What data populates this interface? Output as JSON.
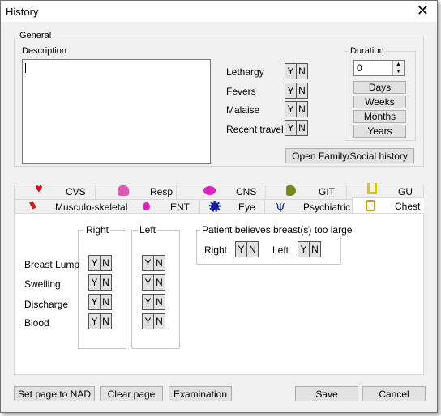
{
  "window": {
    "title": "History",
    "close_glyph": "✕"
  },
  "general": {
    "legend": "General",
    "description_label": "Description",
    "description_value": "",
    "symptoms": [
      {
        "label": "Lethargy",
        "yes": "Y",
        "no": "N"
      },
      {
        "label": "Fevers",
        "yes": "Y",
        "no": "N"
      },
      {
        "label": "Malaise",
        "yes": "Y",
        "no": "N"
      },
      {
        "label": "Recent travel",
        "yes": "Y",
        "no": "N"
      }
    ],
    "family_button": "Open Family/Social history",
    "duration": {
      "legend": "Duration",
      "value": "0",
      "buttons": [
        "Days",
        "Weeks",
        "Months",
        "Years"
      ]
    }
  },
  "tabs": {
    "back_row": [
      {
        "label": "CVS",
        "icon": "heart-icon",
        "color": "#e0001b"
      },
      {
        "label": "Resp",
        "icon": "lungs-icon",
        "color": "#e05ab4"
      },
      {
        "label": "CNS",
        "icon": "brain-icon",
        "color": "#e020c0"
      },
      {
        "label": "GIT",
        "icon": "stomach-icon",
        "color": "#7a8a1a"
      },
      {
        "label": "GU",
        "icon": "kidney-icon",
        "color": "#d8c800"
      }
    ],
    "front_row": [
      {
        "label": "Musculo-skeletal",
        "icon": "bone-icon",
        "color": "#d02020"
      },
      {
        "label": "ENT",
        "icon": "ear-icon",
        "color": "#e020c0"
      },
      {
        "label": "Eye",
        "icon": "eye-icon",
        "color": "#1020a0"
      },
      {
        "label": "Psychiatric",
        "icon": "psi-icon",
        "color": "#1030a0"
      },
      {
        "label": "Chest",
        "icon": "chest-icon",
        "color": "#c8a000",
        "selected": true
      }
    ]
  },
  "chest": {
    "right_legend": "Right",
    "left_legend": "Left",
    "rows": [
      "Breast Lump",
      "Swelling",
      "Discharge",
      "Blood"
    ],
    "yes": "Y",
    "no": "N",
    "believes": {
      "legend": "Patient believes breast(s) too large",
      "right_label": "Right",
      "left_label": "Left"
    }
  },
  "footer": {
    "nad_button": "Set page to NAD",
    "clear_button": "Clear page",
    "exam_button": "Examination",
    "save_button": "Save",
    "cancel_button": "Cancel"
  }
}
